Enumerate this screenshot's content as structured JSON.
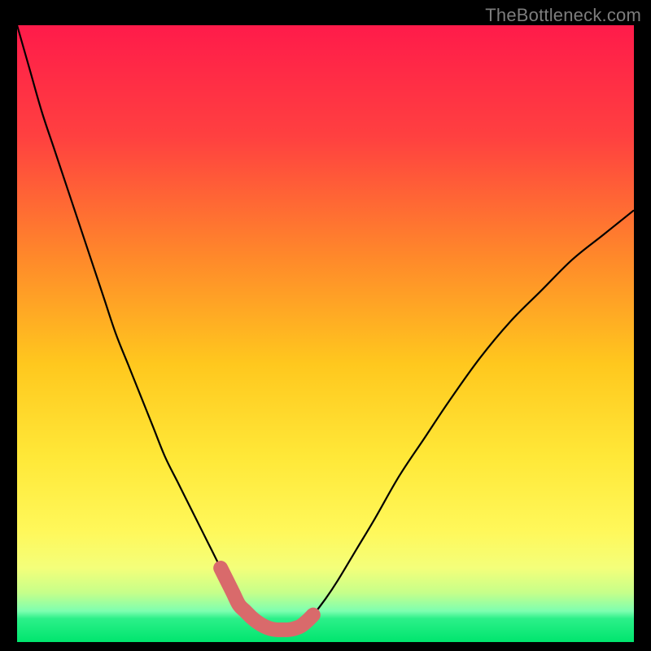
{
  "watermark": "TheBottleneck.com",
  "colors": {
    "bg": "#000000",
    "curve": "#000000",
    "highlight": "#d96a6b",
    "gradient_top": "#ff1b4a",
    "gradient_mid": "#ffd400",
    "gradient_bottom": "#00e56e"
  },
  "chart_data": {
    "type": "line",
    "title": "",
    "xlabel": "",
    "ylabel": "",
    "xlim": [
      0,
      100
    ],
    "ylim": [
      0,
      100
    ],
    "series": [
      {
        "name": "bottleneck-curve",
        "x": [
          0,
          2,
          4,
          6,
          8,
          10,
          12,
          14,
          16,
          18,
          20,
          22,
          24,
          26,
          28,
          30,
          31,
          32,
          33,
          34,
          35,
          36,
          37,
          38,
          39,
          40,
          41,
          42,
          43,
          44,
          45,
          46,
          47,
          48,
          50,
          52,
          55,
          58,
          62,
          66,
          70,
          75,
          80,
          85,
          90,
          95,
          100
        ],
        "y": [
          100,
          93,
          86,
          80,
          74,
          68,
          62,
          56,
          50,
          45,
          40,
          35,
          30,
          26,
          22,
          18,
          16,
          14,
          12,
          10,
          8,
          6,
          5,
          4,
          3.2,
          2.6,
          2.2,
          2,
          2,
          2,
          2.2,
          2.6,
          3.4,
          4.4,
          7,
          10,
          15,
          20,
          27,
          33,
          39,
          46,
          52,
          57,
          62,
          66,
          70
        ]
      },
      {
        "name": "highlight-segment",
        "x": [
          33,
          34,
          35,
          36,
          37,
          38,
          39,
          40,
          41,
          42,
          43,
          44,
          45,
          46,
          47,
          48
        ],
        "y": [
          12,
          10,
          8,
          6,
          5,
          4,
          3.2,
          2.6,
          2.2,
          2,
          2,
          2,
          2.2,
          2.6,
          3.4,
          4.4
        ]
      }
    ],
    "gradient_stops_y_pct": {
      "red": 0,
      "orange": 38,
      "yellow": 62,
      "yellow_green": 86,
      "pale_green": 91,
      "green_band_start": 95,
      "green": 100
    }
  }
}
